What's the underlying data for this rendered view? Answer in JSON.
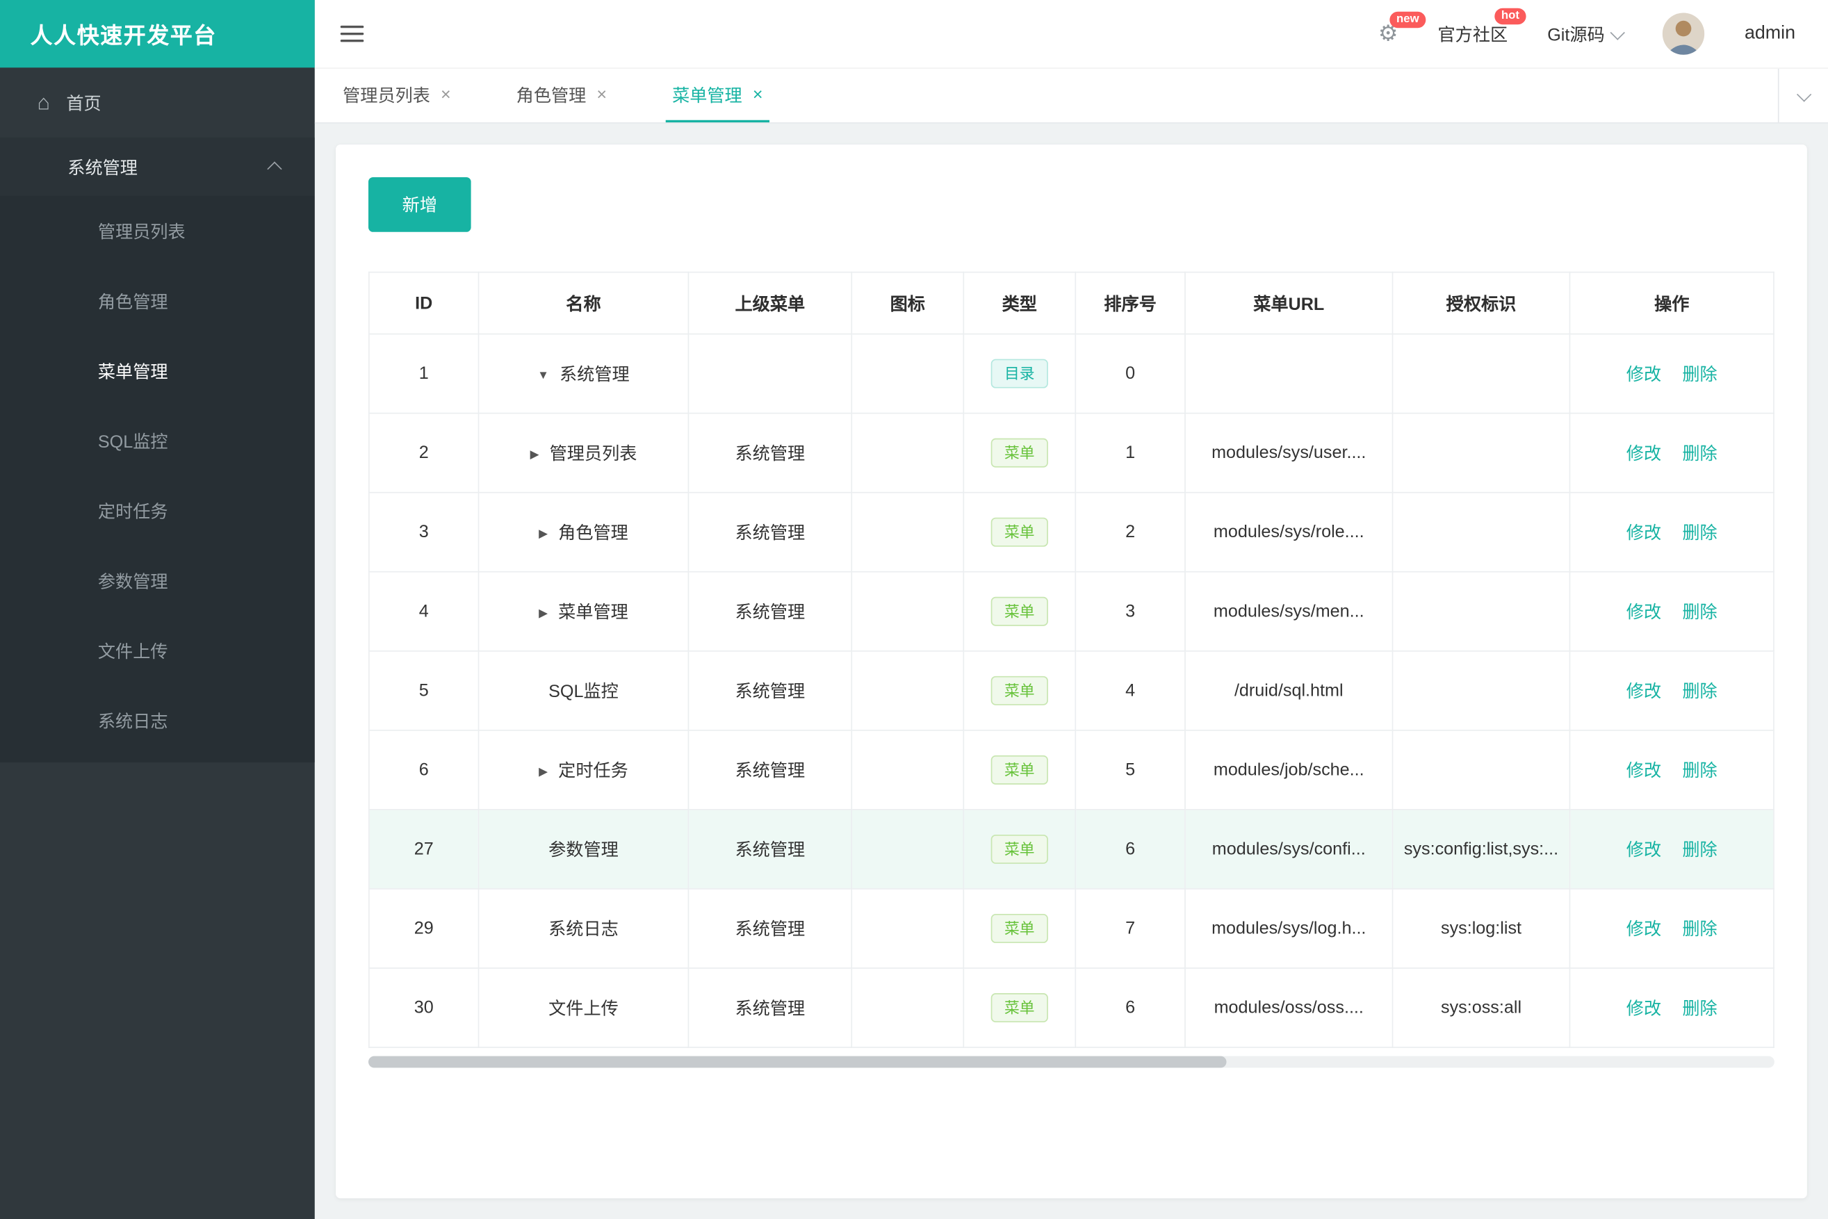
{
  "app": {
    "title": "人人快速开发平台"
  },
  "header": {
    "settings_badge": "new",
    "community_label": "官方社区",
    "community_badge": "hot",
    "git_label": "Git源码",
    "username": "admin"
  },
  "sidebar": {
    "home_label": "首页",
    "group_label": "系统管理",
    "active_item": "菜单管理",
    "items": [
      "管理员列表",
      "角色管理",
      "菜单管理",
      "SQL监控",
      "定时任务",
      "参数管理",
      "文件上传",
      "系统日志"
    ]
  },
  "tabs": {
    "items": [
      {
        "label": "管理员列表",
        "active": false
      },
      {
        "label": "角色管理",
        "active": false
      },
      {
        "label": "菜单管理",
        "active": true
      }
    ]
  },
  "toolbar": {
    "add_label": "新增"
  },
  "table": {
    "columns": [
      "ID",
      "名称",
      "上级菜单",
      "图标",
      "类型",
      "排序号",
      "菜单URL",
      "授权标识",
      "操作"
    ],
    "action_labels": [
      "修改",
      "删除"
    ],
    "rows": [
      {
        "id": "1",
        "caret": "down",
        "name": "系统管理",
        "parent": "",
        "icon": "",
        "type": "目录",
        "type_kind": "dir",
        "order": "0",
        "url": "",
        "perms": "",
        "highlight": false
      },
      {
        "id": "2",
        "caret": "right",
        "name": "管理员列表",
        "parent": "系统管理",
        "icon": "",
        "type": "菜单",
        "type_kind": "menu",
        "order": "1",
        "url": "modules/sys/user....",
        "perms": "",
        "highlight": false
      },
      {
        "id": "3",
        "caret": "right",
        "name": "角色管理",
        "parent": "系统管理",
        "icon": "",
        "type": "菜单",
        "type_kind": "menu",
        "order": "2",
        "url": "modules/sys/role....",
        "perms": "",
        "highlight": false
      },
      {
        "id": "4",
        "caret": "right",
        "name": "菜单管理",
        "parent": "系统管理",
        "icon": "",
        "type": "菜单",
        "type_kind": "menu",
        "order": "3",
        "url": "modules/sys/men...",
        "perms": "",
        "highlight": false
      },
      {
        "id": "5",
        "caret": "",
        "name": "SQL监控",
        "parent": "系统管理",
        "icon": "",
        "type": "菜单",
        "type_kind": "menu",
        "order": "4",
        "url": "/druid/sql.html",
        "perms": "",
        "highlight": false
      },
      {
        "id": "6",
        "caret": "right",
        "name": "定时任务",
        "parent": "系统管理",
        "icon": "",
        "type": "菜单",
        "type_kind": "menu",
        "order": "5",
        "url": "modules/job/sche...",
        "perms": "",
        "highlight": false
      },
      {
        "id": "27",
        "caret": "",
        "name": "参数管理",
        "parent": "系统管理",
        "icon": "",
        "type": "菜单",
        "type_kind": "menu",
        "order": "6",
        "url": "modules/sys/confi...",
        "perms": "sys:config:list,sys:...",
        "highlight": true
      },
      {
        "id": "29",
        "caret": "",
        "name": "系统日志",
        "parent": "系统管理",
        "icon": "",
        "type": "菜单",
        "type_kind": "menu",
        "order": "7",
        "url": "modules/sys/log.h...",
        "perms": "sys:log:list",
        "highlight": false
      },
      {
        "id": "30",
        "caret": "",
        "name": "文件上传",
        "parent": "系统管理",
        "icon": "",
        "type": "菜单",
        "type_kind": "menu",
        "order": "6",
        "url": "modules/oss/oss....",
        "perms": "sys:oss:all",
        "highlight": false
      }
    ]
  },
  "colors": {
    "primary": "#17b3a3",
    "badge_red": "#fb5b5b",
    "tag_dir_color": "#17b3a3",
    "tag_menu_color": "#67c23a"
  }
}
